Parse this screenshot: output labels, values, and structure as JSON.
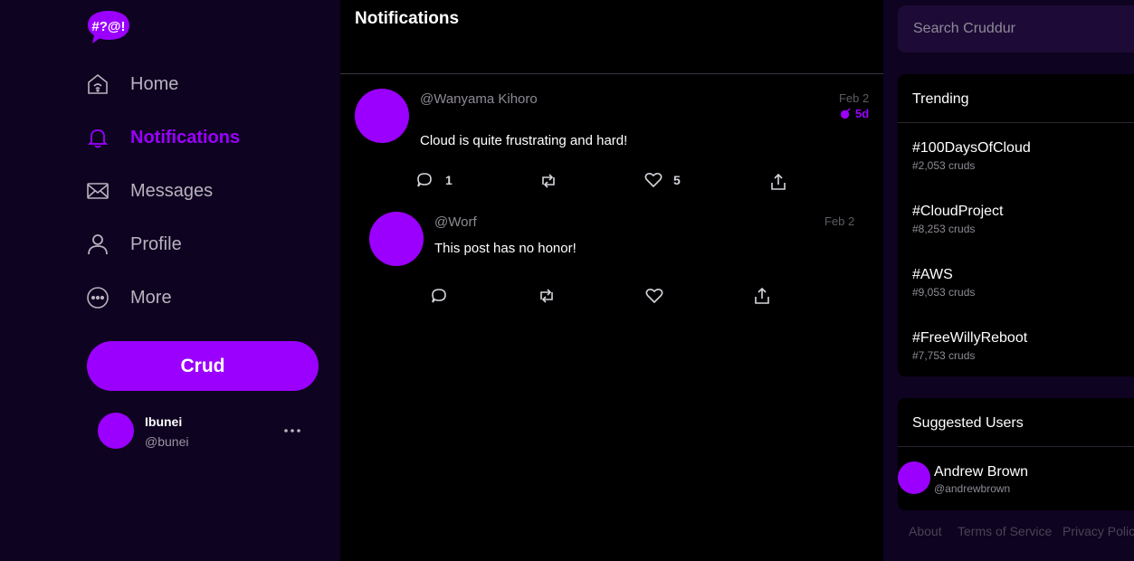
{
  "logo": {
    "text": "#?@!"
  },
  "nav": {
    "items": [
      {
        "label": "Home",
        "icon": "home-icon"
      },
      {
        "label": "Notifications",
        "icon": "bell-icon",
        "active": true
      },
      {
        "label": "Messages",
        "icon": "envelope-icon"
      },
      {
        "label": "Profile",
        "icon": "person-icon"
      },
      {
        "label": "More",
        "icon": "more-circle-icon"
      }
    ]
  },
  "crud_button": {
    "label": "Crud"
  },
  "current_user": {
    "name": "Ibunei",
    "handle": "@bunei"
  },
  "main": {
    "title": "Notifications",
    "posts": [
      {
        "handle": "@Wanyama Kihoro",
        "date": "Feb 2",
        "ttl": "5d",
        "text": "Cloud is quite frustrating and hard!",
        "replies": "1",
        "likes": "5"
      },
      {
        "handle": "@Worf",
        "date": "Feb 2",
        "text": "This post has no honor!"
      }
    ]
  },
  "search": {
    "placeholder": "Search Cruddur"
  },
  "trending": {
    "title": "Trending",
    "items": [
      {
        "tag": "#100DaysOfCloud",
        "count": "#2,053 cruds"
      },
      {
        "tag": "#CloudProject",
        "count": "#8,253 cruds"
      },
      {
        "tag": "#AWS",
        "count": "#9,053 cruds"
      },
      {
        "tag": "#FreeWillyReboot",
        "count": "#7,753 cruds"
      }
    ]
  },
  "suggested": {
    "title": "Suggested Users",
    "users": [
      {
        "name": "Andrew Brown",
        "handle": "@andrewbrown"
      }
    ]
  },
  "footer": {
    "links": [
      "About",
      "Terms of Service",
      "Privacy Policy"
    ]
  },
  "colors": {
    "accent": "#9b00ff",
    "sidebar_bg": "#0e0320",
    "main_bg": "#000000",
    "search_bg": "#1d0a36"
  }
}
